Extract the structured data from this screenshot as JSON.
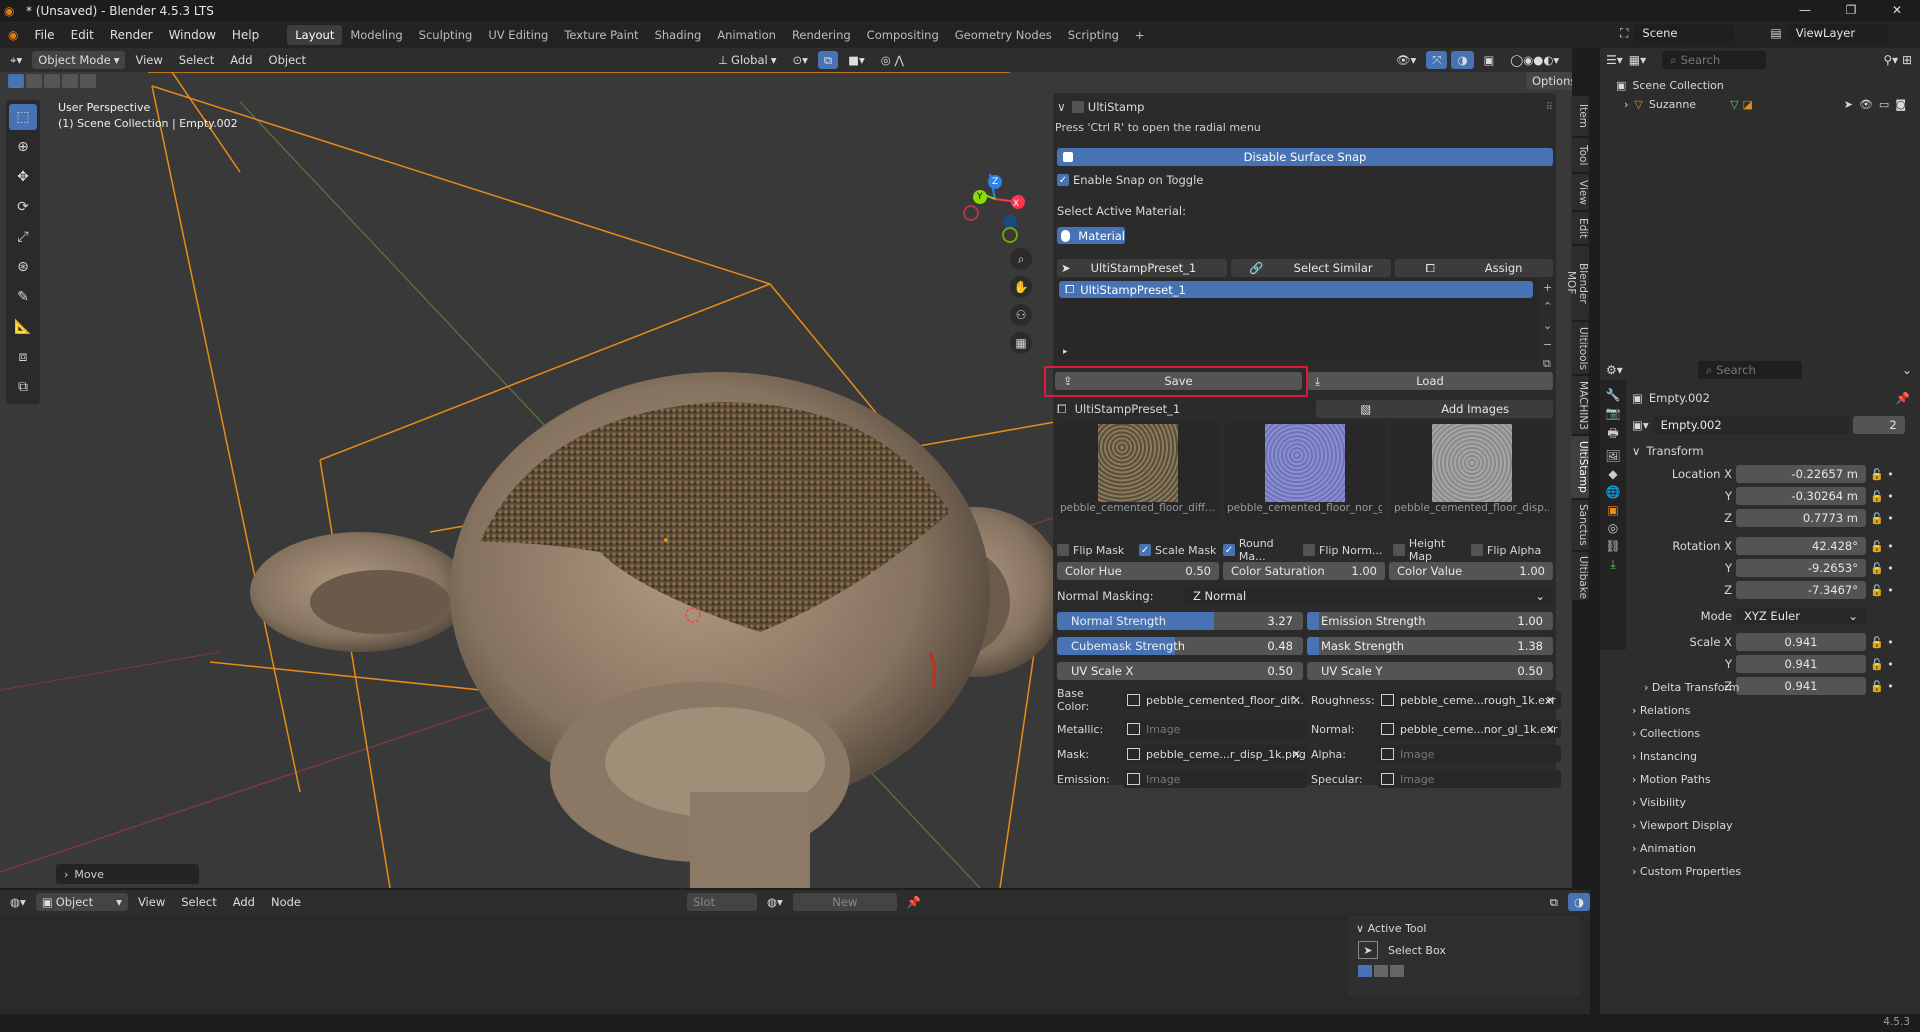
{
  "app": {
    "title": "* (Unsaved) - Blender 4.5.3 LTS",
    "version": "4.5.3"
  },
  "menu": [
    "File",
    "Edit",
    "Render",
    "Window",
    "Help"
  ],
  "workspaces": [
    "Layout",
    "Modeling",
    "Sculpting",
    "UV Editing",
    "Texture Paint",
    "Shading",
    "Animation",
    "Rendering",
    "Compositing",
    "Geometry Nodes",
    "Scripting",
    "+"
  ],
  "topright": {
    "scene": "Scene",
    "viewlayer": "ViewLayer"
  },
  "viewport_header": {
    "mode": "Object Mode",
    "menus": [
      "View",
      "Select",
      "Add",
      "Object"
    ],
    "transform": "Global",
    "options": "Options"
  },
  "viewport": {
    "perspective": "User Perspective",
    "collection": "(1) Scene Collection | Empty.002",
    "move_panel": "Move",
    "gizmo": {
      "x": "X",
      "y": "Y",
      "z": "Z"
    }
  },
  "ntabs": [
    "Item",
    "Tool",
    "View",
    "Edit",
    "Blender MOF",
    "Ultitools",
    "MACHIN3",
    "UltiStamp",
    "Sanctus",
    "Ultibake"
  ],
  "ultistamp": {
    "header": "UltiStamp",
    "hint": "Press 'Ctrl R' to open the radial menu",
    "disable_snap": "Disable Surface Snap",
    "enable_snap_toggle": "Enable Snap on Toggle",
    "select_material_label": "Select Active Material:",
    "material_btn": "Material",
    "preset_field": "UltiStampPreset_1",
    "select_similar": "Select Similar",
    "assign": "Assign",
    "list_item": "UltiStampPreset_1",
    "save": "Save",
    "load": "Load",
    "preset_name": "UltiStampPreset_1",
    "add_images": "Add Images",
    "thumbnails": [
      {
        "caption": "pebble_cemented_floor_diff...",
        "color": "#7b6a4e"
      },
      {
        "caption": "pebble_cemented_floor_nor_gl...",
        "color": "#7b7fc0"
      },
      {
        "caption": "pebble_cemented_floor_disp...",
        "color": "#9a9a9a"
      }
    ],
    "checkboxes": [
      {
        "label": "Flip Mask",
        "on": false
      },
      {
        "label": "Scale Mask",
        "on": true
      },
      {
        "label": "Round Ma...",
        "on": true
      },
      {
        "label": "Flip Norm...",
        "on": false
      },
      {
        "label": "Height Map",
        "on": false
      },
      {
        "label": "Flip Alpha",
        "on": false
      }
    ],
    "color_fields": [
      {
        "label": "Color Hue",
        "value": "0.50"
      },
      {
        "label": "Color Saturation",
        "value": "1.00"
      },
      {
        "label": "Color Value",
        "value": "1.00"
      }
    ],
    "normal_masking_label": "Normal Masking:",
    "normal_masking_value": "Z Normal",
    "sliders": [
      {
        "label": "Normal Strength",
        "value": "3.27",
        "fill": 0.64
      },
      {
        "label": "Emission Strength",
        "value": "1.00",
        "fill": 0.05
      },
      {
        "label": "Cubemask Strength",
        "value": "0.48",
        "fill": 0.48
      },
      {
        "label": "Mask Strength",
        "value": "1.38",
        "fill": 0.05
      },
      {
        "label": "UV Scale X",
        "value": "0.50",
        "fill": 0.0
      },
      {
        "label": "UV Scale Y",
        "value": "0.50",
        "fill": 0.0
      }
    ],
    "image_slots": [
      {
        "label": "Base Color:",
        "value": "pebble_cemented_floor_dif..."
      },
      {
        "label": "Roughness:",
        "value": "pebble_ceme...rough_1k.exr"
      },
      {
        "label": "Metallic:",
        "value": ""
      },
      {
        "label": "Normal:",
        "value": "pebble_ceme...nor_gl_1k.exr"
      },
      {
        "label": "Mask:",
        "value": "pebble_ceme...r_disp_1k.png"
      },
      {
        "label": "Alpha:",
        "value": ""
      },
      {
        "label": "Emission:",
        "value": ""
      },
      {
        "label": "Specular:",
        "value": ""
      }
    ],
    "image_placeholder": "Image"
  },
  "outliner": {
    "search": "Search",
    "scene_collection": "Scene Collection",
    "item": "Suzanne"
  },
  "properties": {
    "search": "Search",
    "object_name": "Empty.002",
    "datablock": "Empty.002",
    "users": "2",
    "transform": "Transform",
    "location": [
      {
        "label": "Location X",
        "value": "-0.22657 m"
      },
      {
        "label": "Y",
        "value": "-0.30264 m"
      },
      {
        "label": "Z",
        "value": "0.7773 m"
      }
    ],
    "rotation": [
      {
        "label": "Rotation X",
        "value": "42.428°"
      },
      {
        "label": "Y",
        "value": "-9.2653°"
      },
      {
        "label": "Z",
        "value": "-7.3467°"
      }
    ],
    "mode_label": "Mode",
    "mode_value": "XYZ Euler",
    "scale": [
      {
        "label": "Scale X",
        "value": "0.941"
      },
      {
        "label": "Y",
        "value": "0.941"
      },
      {
        "label": "Z",
        "value": "0.941"
      }
    ],
    "delta": "Delta Transform",
    "sections": [
      "Relations",
      "Collections",
      "Instancing",
      "Motion Paths",
      "Visibility",
      "Viewport Display",
      "Animation",
      "Custom Properties"
    ]
  },
  "shader_header": {
    "object": "Object",
    "menus": [
      "View",
      "Select",
      "Add",
      "Node"
    ],
    "slot": "Slot",
    "new": "New"
  },
  "active_tool": {
    "title": "Active Tool",
    "name": "Select Box"
  },
  "colors": {
    "accent": "#4772b3",
    "highlight": "#e0183c",
    "orange": "#e88b17"
  }
}
